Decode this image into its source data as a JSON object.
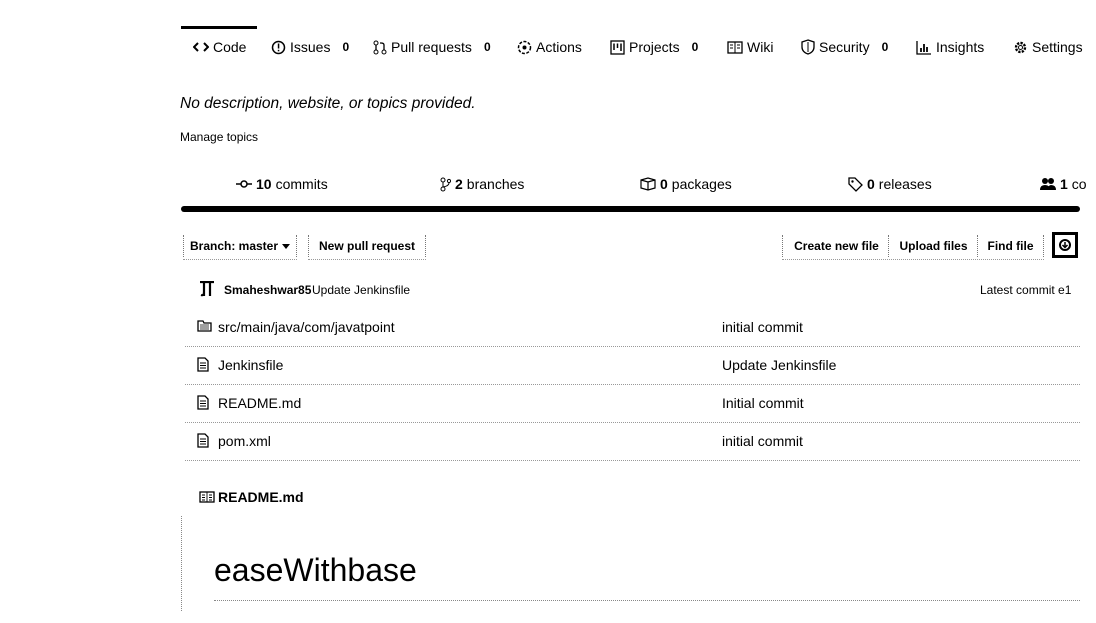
{
  "tabs": [
    {
      "label": "Code",
      "icon": "code-icon",
      "count": ""
    },
    {
      "label": "Issues",
      "icon": "issue-icon",
      "count": "0"
    },
    {
      "label": "Pull requests",
      "icon": "pull-request-icon",
      "count": "0"
    },
    {
      "label": "Actions",
      "icon": "actions-icon",
      "count": ""
    },
    {
      "label": "Projects",
      "icon": "project-icon",
      "count": "0"
    },
    {
      "label": "Wiki",
      "icon": "book-icon",
      "count": ""
    },
    {
      "label": "Security",
      "icon": "shield-icon",
      "count": "0"
    },
    {
      "label": "Insights",
      "icon": "graph-icon",
      "count": ""
    },
    {
      "label": "Settings",
      "icon": "gear-icon",
      "count": ""
    }
  ],
  "repo": {
    "description": "No description, website, or topics provided.",
    "manage_topics": "Manage topics"
  },
  "stats": {
    "commits": {
      "num": "10",
      "label": "commits"
    },
    "branches": {
      "num": "2",
      "label": "branches"
    },
    "packages": {
      "num": "0",
      "label": "packages"
    },
    "releases": {
      "num": "0",
      "label": "releases"
    },
    "contributors": {
      "num": "1",
      "label": "co"
    }
  },
  "toolbar": {
    "branch_label": "Branch: master",
    "new_pr": "New pull request",
    "create_file": "Create new file",
    "upload_files": "Upload files",
    "find_file": "Find file"
  },
  "commit": {
    "author": "Smaheshwar85",
    "message": "Update Jenkinsfile",
    "latest": "Latest commit e1"
  },
  "files": [
    {
      "name": "src/main/java/com/javatpoint",
      "type": "folder",
      "message": "initial commit"
    },
    {
      "name": "Jenkinsfile",
      "type": "file",
      "message": "Update Jenkinsfile"
    },
    {
      "name": "README.md",
      "type": "file",
      "message": "Initial commit"
    },
    {
      "name": "pom.xml",
      "type": "file",
      "message": "initial commit"
    }
  ],
  "readme": {
    "header": "README.md",
    "title": "easeWithbase"
  }
}
